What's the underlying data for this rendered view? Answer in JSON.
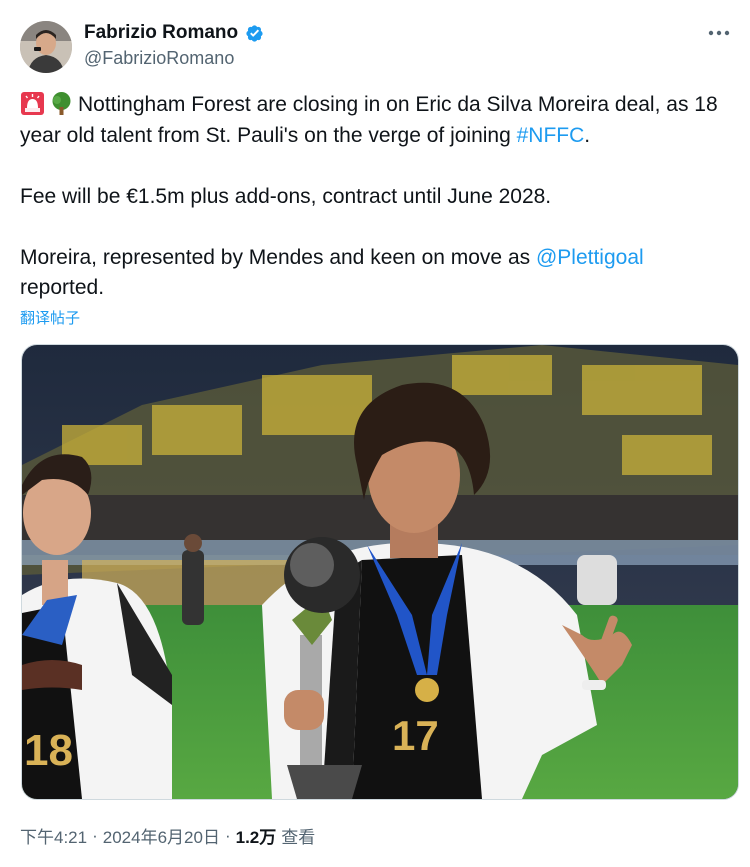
{
  "author": {
    "name": "Fabrizio Romano",
    "handle": "@FabrizioRomano",
    "verified_icon": "verified-badge-icon"
  },
  "menu": {
    "more_icon": "more-options-icon"
  },
  "tweet": {
    "emojis": [
      "rotating-light-icon",
      "tree-icon"
    ],
    "line1_text": "Nottingham Forest are closing in on Eric da Silva Moreira deal, as 18 year old talent from St. Pauli's on the verge of joining ",
    "line1_hashtag": "#NFFC",
    "line1_end": ".",
    "paragraph2": "Fee will be €1.5m plus add-ons, contract until June 2028.",
    "paragraph3_text": "Moreira, represented by Mendes and keen on move as ",
    "paragraph3_mention": "@Plettigoal",
    "paragraph3_end": " reported."
  },
  "translate_label": "翻译帖子",
  "media": {
    "description_icon": "photo",
    "jersey_numbers": [
      "18",
      "17"
    ]
  },
  "footer": {
    "time": "下午4:21",
    "separator1": "·",
    "date": "2024年6月20日",
    "separator2": "·",
    "views_count": "1.2万",
    "views_label": "查看"
  },
  "colors": {
    "link": "#1d9bf0",
    "secondary_text": "#536471",
    "primary_text": "#0f1419"
  }
}
